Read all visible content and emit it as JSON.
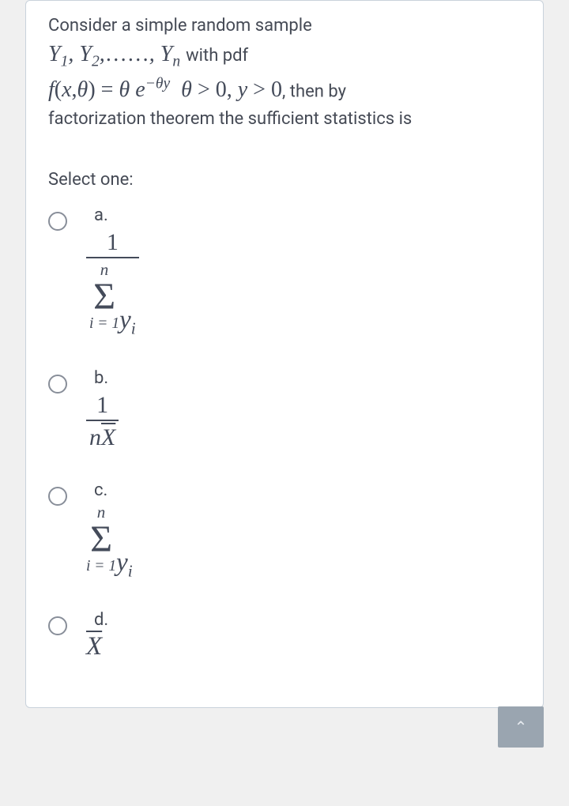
{
  "stem": {
    "line1": "Consider a simple random sample",
    "seq_raw": "Y₁, Y₂, ……, Yₙ",
    "with_pdf": " with pdf",
    "pdf_raw": "f(x,θ) = θ e^{−θy}  θ > 0, y > 0",
    "then_by": ", then by",
    "line3": "factorization theorem the sufficient statistics is"
  },
  "select_one": "Select one:",
  "options": {
    "a": {
      "label": "a.",
      "math_desc": "1 / (Σ_{i=1}^{n} y_i)"
    },
    "b": {
      "label": "b.",
      "math_desc": "1 / (n X̄)"
    },
    "c": {
      "label": "c.",
      "math_desc": "Σ_{i=1}^{n} y_i"
    },
    "d": {
      "label": "d.",
      "math_desc": "X̄"
    }
  },
  "scroll_top_icon": "⌃"
}
